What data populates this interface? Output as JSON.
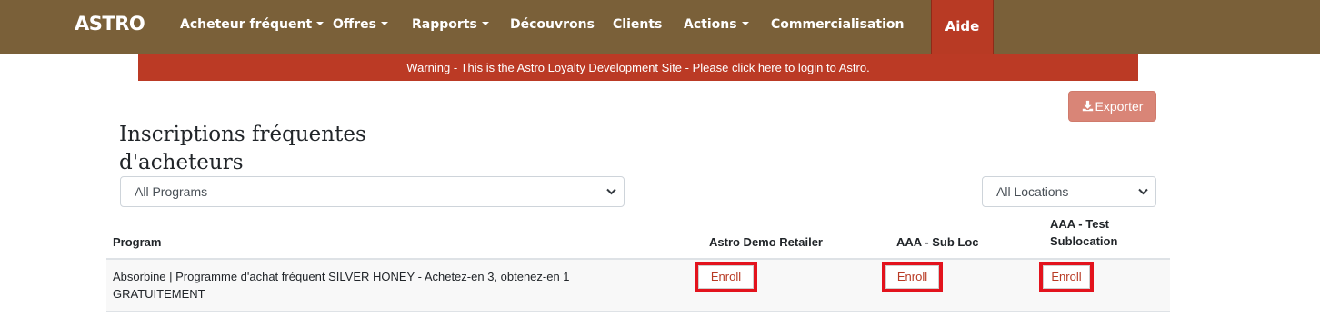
{
  "nav": {
    "brand": "ASTRO",
    "items": [
      {
        "label": "Acheteur fréquent",
        "dropdown": true
      },
      {
        "label": "Offres",
        "dropdown": true
      },
      {
        "label": "Rapports",
        "dropdown": true
      },
      {
        "label": "Découvrons",
        "dropdown": false
      },
      {
        "label": "Clients",
        "dropdown": false
      },
      {
        "label": "Actions",
        "dropdown": true
      },
      {
        "label": "Commercialisation",
        "dropdown": false
      }
    ],
    "aide": "Aide"
  },
  "warning_banner": "Warning - This is the Astro Loyalty Development Site - Please click here to login to Astro.",
  "toolbar": {
    "export_label": "Exporter",
    "export_icon": "download-icon"
  },
  "page": {
    "title_line1": "Inscriptions fréquentes",
    "title_line2": "d'acheteurs"
  },
  "filters": {
    "program_select": "All Programs",
    "location_select": "All Locations"
  },
  "table": {
    "headers": [
      "Program",
      "Astro Demo Retailer",
      "AAA - Sub Loc",
      "AAA - Test",
      "Sublocation"
    ],
    "rows": [
      {
        "program_line1": "Absorbine | Programme d'achat fréquent SILVER HONEY - Achetez-en 3, obtenez-en 1",
        "program_line2": "GRATUITEMENT",
        "actions": [
          "Enroll",
          "Enroll",
          "Enroll"
        ]
      }
    ]
  },
  "colors": {
    "navbar": "#7a6039",
    "accent": "#b83a24",
    "export_button": "#d98577",
    "highlight": "#e3131d"
  }
}
